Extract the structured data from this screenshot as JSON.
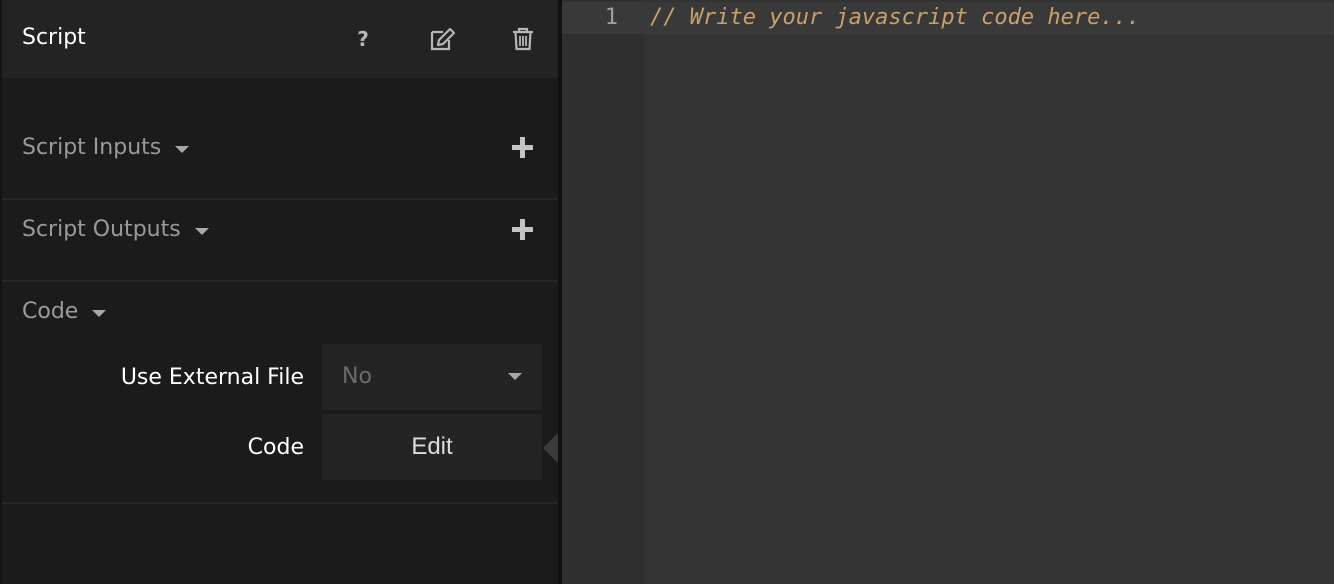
{
  "panel": {
    "title": "Script",
    "header_icons": [
      "help-icon",
      "edit-icon",
      "trash-icon"
    ],
    "help_glyph": "?"
  },
  "sections": {
    "inputs": {
      "label": "Script Inputs"
    },
    "outputs": {
      "label": "Script Outputs"
    },
    "code": {
      "label": "Code",
      "use_external_file_label": "Use External File",
      "use_external_file_value": "No",
      "code_label": "Code",
      "edit_button_label": "Edit"
    }
  },
  "editor": {
    "line_number": "1",
    "code": "// Write your javascript code here...",
    "code_color": "#c8a069"
  },
  "colors": {
    "panel_bg": "#1b1b1b",
    "header_bg": "#232323",
    "editor_bg": "#333333"
  }
}
